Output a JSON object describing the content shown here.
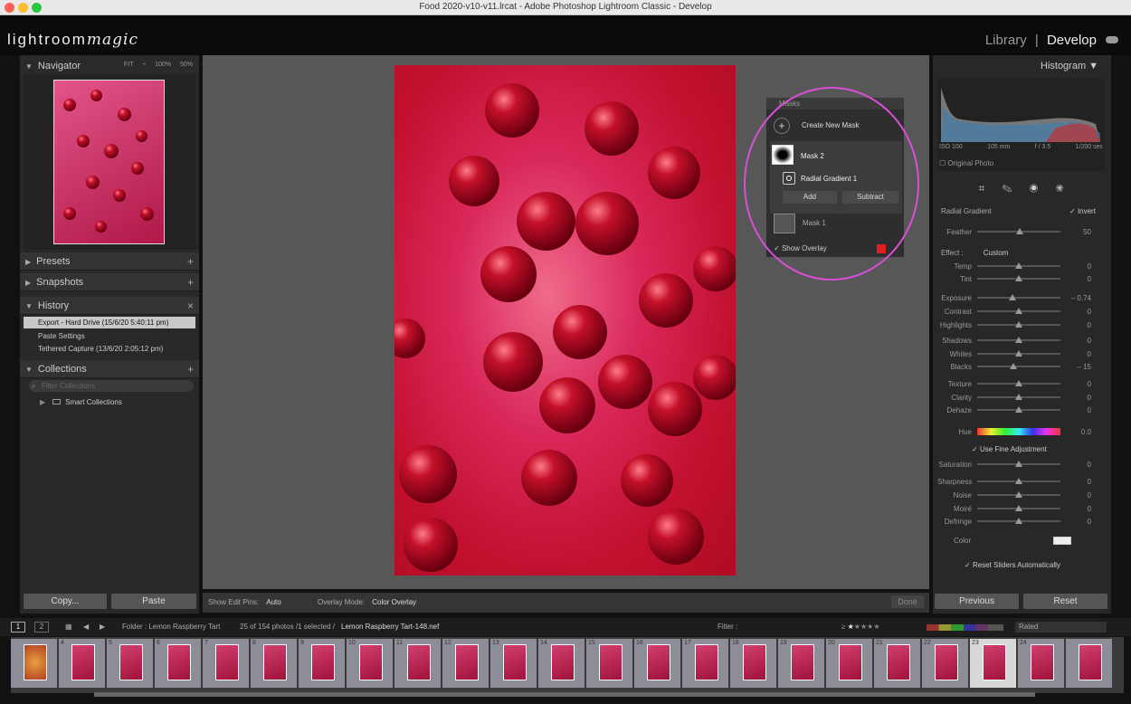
{
  "window": {
    "title": "Food 2020-v10-v11.lrcat - Adobe Photoshop Lightroom Classic - Develop"
  },
  "identity": {
    "logo_plain": "lightroom",
    "logo_script": "magic",
    "module_library": "Library",
    "module_sep": "|",
    "module_develop": "Develop"
  },
  "left": {
    "navigator": {
      "title": "Navigator",
      "opts": [
        "FIT ÷",
        "100%",
        "50%",
        "÷"
      ]
    },
    "presets": "Presets",
    "snapshots": "Snapshots",
    "history": {
      "title": "History",
      "items": [
        "Export - Hard Drive (15/6/20 5:40:11 pm)",
        "Paste Settings",
        "Tethered Capture (13/6/20 2:05:12 pm)"
      ]
    },
    "collections": {
      "title": "Collections",
      "search_placeholder": "Filter Collections",
      "smart": "Smart Collections"
    },
    "copy": "Copy...",
    "paste": "Paste"
  },
  "toolbar": {
    "pins_label": "Show Edit Pins:",
    "pins_value": "Auto",
    "overlay_label": "Overlay Mode:",
    "overlay_value": "Color Overlay",
    "done": "Done"
  },
  "masks": {
    "title": "Masks",
    "create": "Create New Mask",
    "mask2": "Mask 2",
    "radial": "Radial Gradient 1",
    "add": "Add",
    "subtract": "Subtract",
    "mask1": "Mask 1",
    "show_overlay": "Show Overlay"
  },
  "right": {
    "histogram": {
      "title": "Histogram",
      "iso": "ISO 100",
      "focal": "105 mm",
      "aperture": "f / 3.5",
      "shutter": "1/200 sec",
      "original": "Original Photo"
    },
    "radial_label": "Radial Gradient",
    "invert": "Invert",
    "feather_label": "Feather",
    "feather_value": "50",
    "effect_label": "Effect :",
    "effect_value": "Custom",
    "sliders": [
      {
        "label": "Temp",
        "value": "0",
        "pos": 0.5
      },
      {
        "label": "Tint",
        "value": "0",
        "pos": 0.5
      },
      {
        "label": "Exposure",
        "value": "– 0.74",
        "pos": 0.42
      },
      {
        "label": "Contrast",
        "value": "0",
        "pos": 0.5
      },
      {
        "label": "Highlights",
        "value": "0",
        "pos": 0.5
      },
      {
        "label": "Shadows",
        "value": "0",
        "pos": 0.5
      },
      {
        "label": "Whites",
        "value": "0",
        "pos": 0.5
      },
      {
        "label": "Blacks",
        "value": "– 15",
        "pos": 0.43
      },
      {
        "label": "Texture",
        "value": "0",
        "pos": 0.5
      },
      {
        "label": "Clarity",
        "value": "0",
        "pos": 0.5
      },
      {
        "label": "Dehaze",
        "value": "0",
        "pos": 0.5
      }
    ],
    "hue_label": "Hue",
    "hue_value": "0.0",
    "fine": "Use Fine Adjustment",
    "sliders2": [
      {
        "label": "Saturation",
        "value": "0",
        "pos": 0.5
      },
      {
        "label": "Sharpness",
        "value": "0",
        "pos": 0.5
      },
      {
        "label": "Noise",
        "value": "0",
        "pos": 0.5
      },
      {
        "label": "Moiré",
        "value": "0",
        "pos": 0.5
      },
      {
        "label": "Defringe",
        "value": "0",
        "pos": 0.5
      }
    ],
    "color_label": "Color",
    "reset": "Reset Sliders Automatically",
    "previous": "Previous",
    "reset_btn": "Reset"
  },
  "filmbar": {
    "view1": "1",
    "view2": "2",
    "folder": "Folder : Lemon Raspberry Tart",
    "count": "25 of 154 photos /1 selected /",
    "filename": "Lemon Raspberry Tart-148.nef",
    "filter": "Filter :",
    "rated": "Rated"
  },
  "filmstrip": {
    "numbers": [
      "",
      "4",
      "5",
      "6",
      "7",
      "8",
      "9",
      "10",
      "11",
      "12",
      "13",
      "14",
      "15",
      "16",
      "17",
      "18",
      "19",
      "20",
      "21",
      "22",
      "23",
      "24",
      ""
    ]
  }
}
